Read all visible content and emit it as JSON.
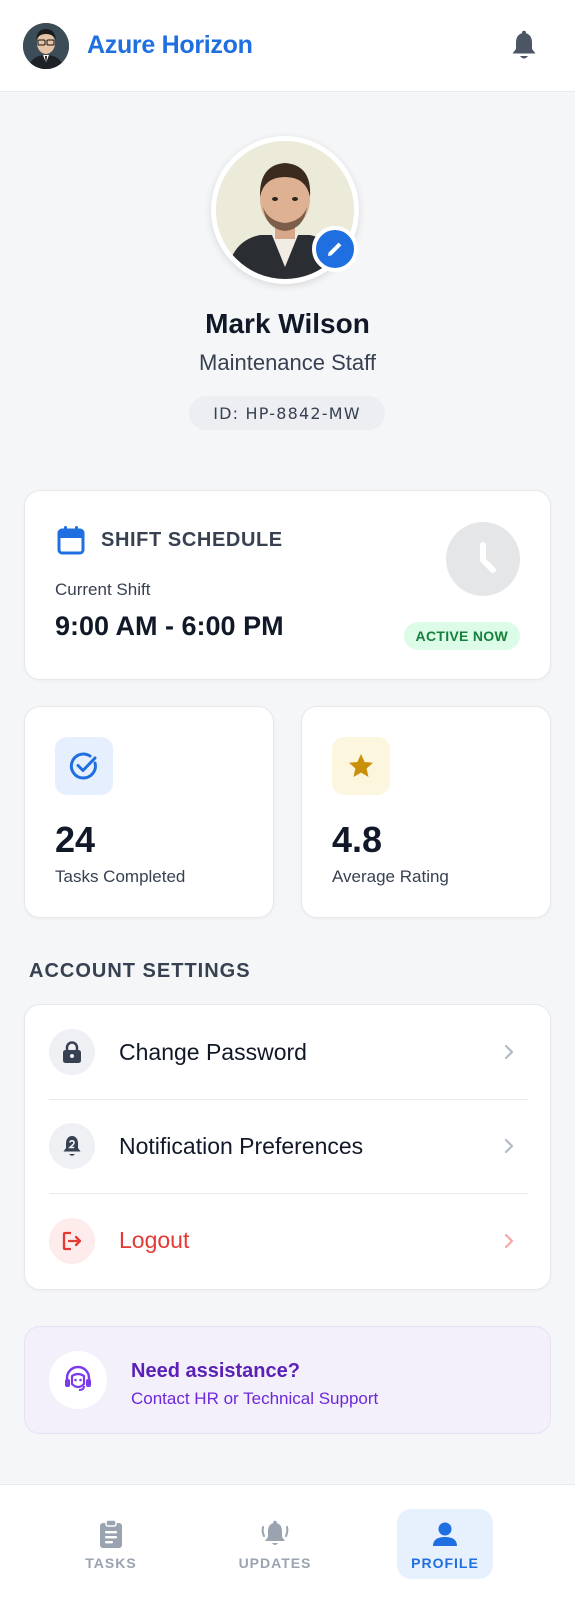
{
  "app": {
    "title": "Azure Horizon"
  },
  "profile": {
    "name": "Mark Wilson",
    "role": "Maintenance Staff",
    "id": "ID: HP-8842-MW"
  },
  "shift": {
    "title": "SHIFT SCHEDULE",
    "label": "Current Shift",
    "time": "9:00 AM - 6:00 PM",
    "status": "ACTIVE NOW"
  },
  "stats": [
    {
      "value": "24",
      "label": "Tasks Completed",
      "icon": "check-circle-icon"
    },
    {
      "value": "4.8",
      "label": "Average Rating",
      "icon": "star-icon"
    }
  ],
  "settings": {
    "heading": "ACCOUNT SETTINGS",
    "items": [
      {
        "label": "Change Password",
        "icon": "lock-icon"
      },
      {
        "label": "Notification Preferences",
        "icon": "notification-bell-icon"
      },
      {
        "label": "Logout",
        "icon": "logout-icon"
      }
    ]
  },
  "help": {
    "title": "Need assistance?",
    "subtitle": "Contact HR or Technical Support"
  },
  "nav": {
    "items": [
      {
        "label": "TASKS",
        "icon": "clipboard-icon"
      },
      {
        "label": "UPDATES",
        "icon": "alarm-bell-icon"
      },
      {
        "label": "PROFILE",
        "icon": "person-icon",
        "active": true
      }
    ]
  },
  "colors": {
    "primary": "#1f6fe0",
    "danger": "#e53935",
    "success_bg": "#dcfce7",
    "success_text": "#15803d",
    "help_accent": "#5b21b6"
  }
}
